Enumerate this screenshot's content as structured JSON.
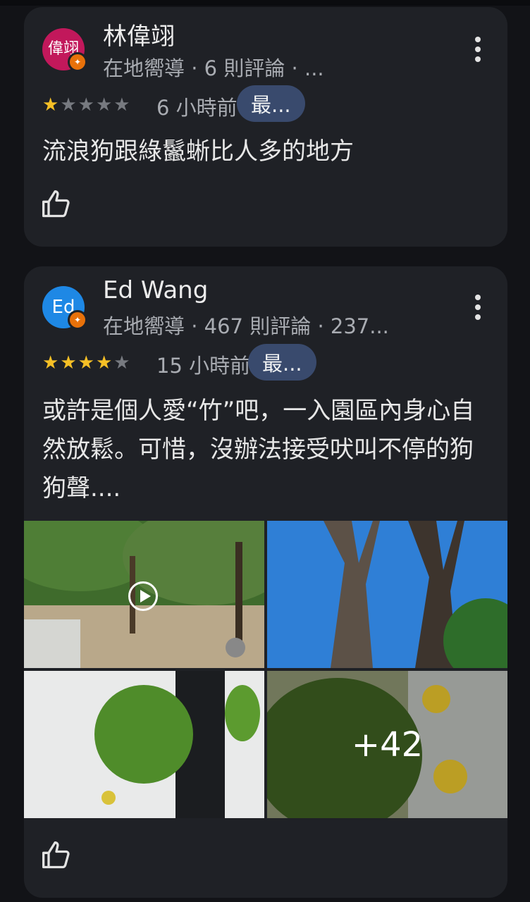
{
  "reviews": [
    {
      "avatar_text": "偉翊",
      "avatar_color": "#c2185b",
      "name": "林偉翊",
      "meta": "在地嚮導 · 6 則評論 · ...",
      "rating": 1,
      "time": "6 小時前",
      "chip": "最...",
      "text": "流浪狗跟綠鬣蜥比人多的地方",
      "like_icon": "thumb-up-icon"
    },
    {
      "avatar_text": "Ed",
      "avatar_color": "#1e88e5",
      "name": "Ed Wang",
      "meta": "在地嚮導 · 467 則評論 · 237...",
      "rating": 4,
      "time": "15 小時前",
      "chip": "最...",
      "text": "或許是個人愛“竹”吧，一入園區內身心自然放鬆。可惜，沒辦法接受吠叫不停的狗狗聲....",
      "photos_more": "+42",
      "like_icon": "thumb-up-icon"
    }
  ],
  "colors": {
    "star_on": "#f6c026",
    "chip_bg": "#394a6d",
    "guide_badge": "#e8710a"
  }
}
